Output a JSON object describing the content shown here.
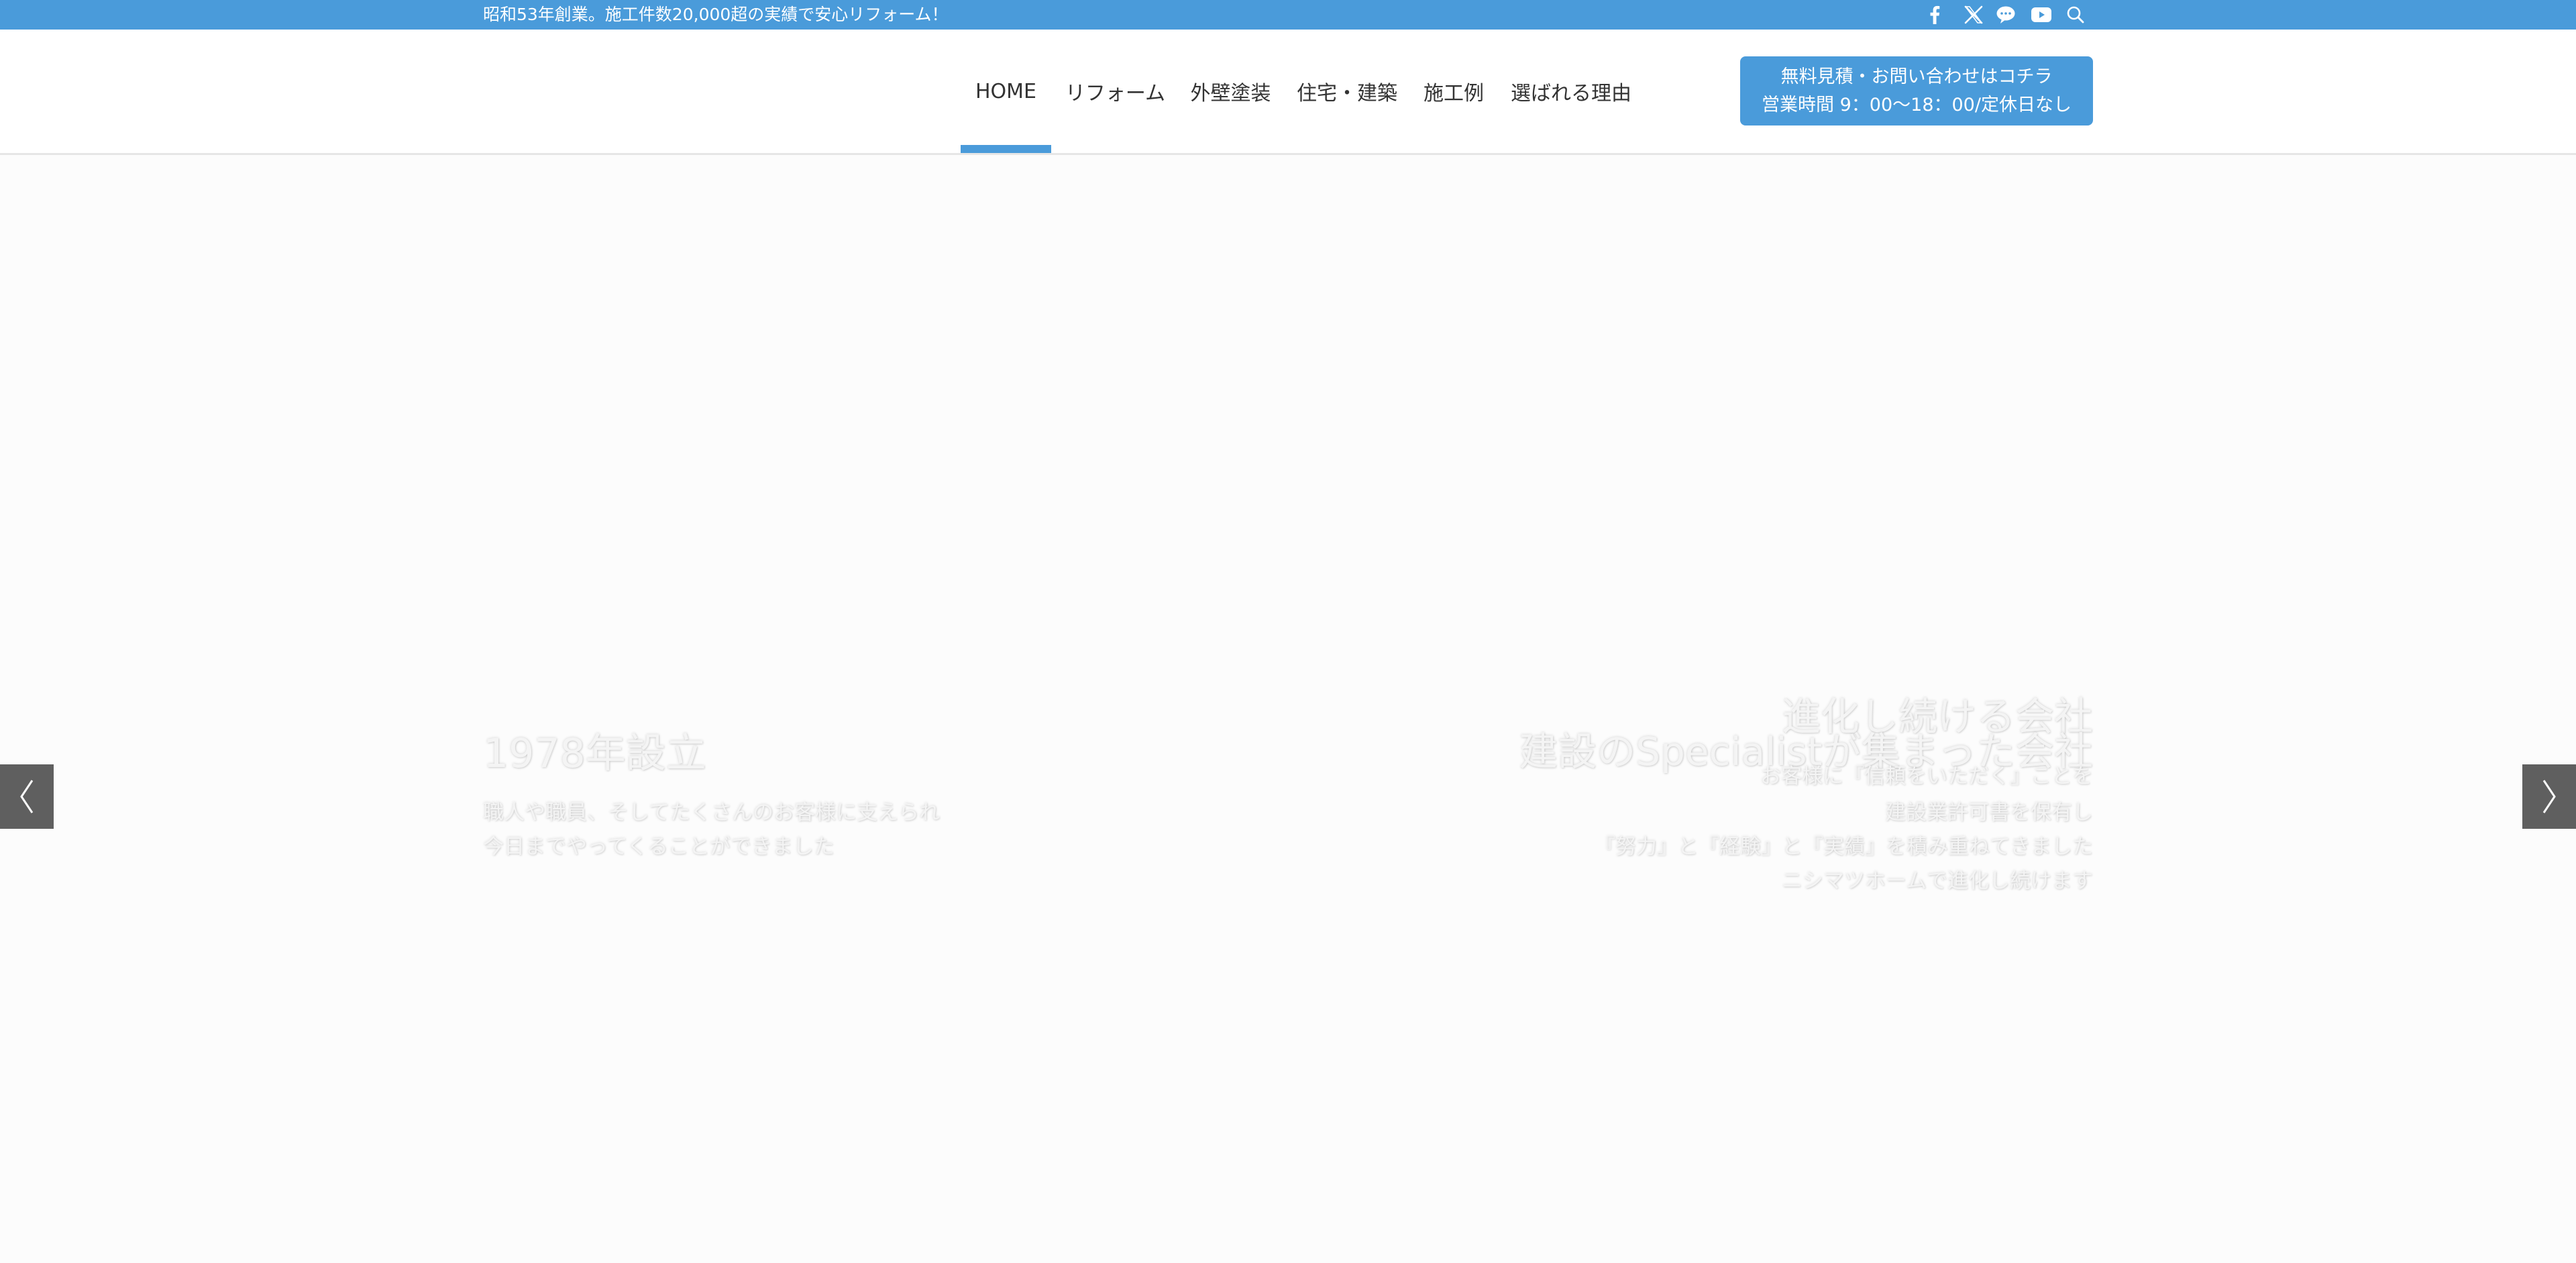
{
  "topbar": {
    "announcement": "昭和53年創業。施工件数20,000超の実績で安心リフォーム！",
    "social_icons": [
      "facebook-icon",
      "x-icon",
      "line-icon",
      "youtube-icon",
      "search-icon"
    ]
  },
  "nav": {
    "items": [
      {
        "label": "HOME",
        "active": true
      },
      {
        "label": "リフォーム",
        "active": false
      },
      {
        "label": "外壁塗装",
        "active": false
      },
      {
        "label": "住宅・建築",
        "active": false
      },
      {
        "label": "施工例",
        "active": false
      },
      {
        "label": "選ばれる理由",
        "active": false
      }
    ]
  },
  "cta": {
    "line1": "無料見積・お問い合わせはコチラ",
    "line2": "営業時間 9：00〜18：00/定休日なし"
  },
  "hero": {
    "left": {
      "title": "1978年設立",
      "lines": [
        "職人や職員、そしてたくさんのお客様に支えられ",
        "今日までやってくることができました"
      ]
    },
    "right": {
      "title_lines": [
        "進化し続ける会社",
        "建設のSpecialistが集まった会社"
      ],
      "lines": [
        "お客様に『信頼をいただく』ことを",
        "建設業許可書を保有し",
        "『努力』と『経験』と『実績』を積み重ねてきました",
        "ニシマツホームで進化し続けます"
      ]
    },
    "prev_icon": "chevron-left-icon",
    "next_icon": "chevron-right-icon"
  },
  "colors": {
    "accent": "#4a9bda",
    "slider_button": "#5f5f5f",
    "hero_background": "#fcfcfc"
  }
}
